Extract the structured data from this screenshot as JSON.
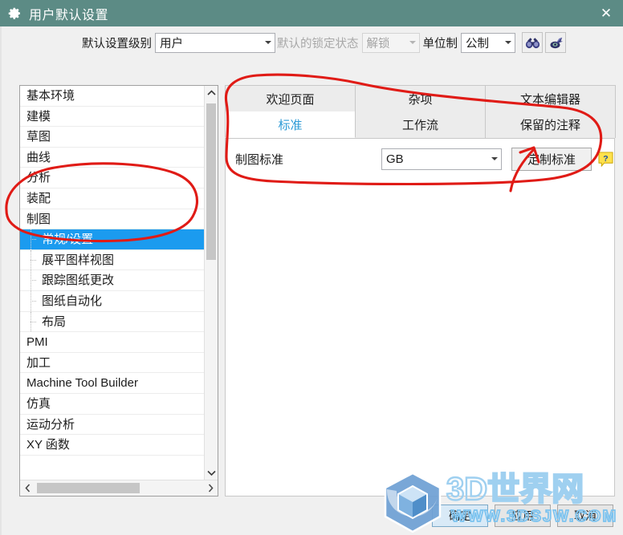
{
  "window": {
    "title": "用户默认设置",
    "gear_icon": "gear-icon",
    "close_label": "✕"
  },
  "toolbar": {
    "level_label": "默认设置级别",
    "level_value": "用户",
    "lock_label": "默认的锁定状态",
    "lock_value": "解锁",
    "lock_disabled": true,
    "units_label": "单位制",
    "units_value": "公制",
    "find_icon": "binoculars-icon",
    "pick_icon": "arrow-pick-icon"
  },
  "tree": {
    "items": [
      {
        "label": "基本环境",
        "level": 0,
        "selected": false
      },
      {
        "label": "建模",
        "level": 0,
        "selected": false
      },
      {
        "label": "草图",
        "level": 0,
        "selected": false
      },
      {
        "label": "曲线",
        "level": 0,
        "selected": false
      },
      {
        "label": "分析",
        "level": 0,
        "selected": false
      },
      {
        "label": "装配",
        "level": 0,
        "selected": false
      },
      {
        "label": "制图",
        "level": 0,
        "selected": false
      },
      {
        "label": "常规/设置",
        "level": 1,
        "selected": true
      },
      {
        "label": "展平图样视图",
        "level": 1,
        "selected": false
      },
      {
        "label": "跟踪图纸更改",
        "level": 1,
        "selected": false
      },
      {
        "label": "图纸自动化",
        "level": 1,
        "selected": false
      },
      {
        "label": "布局",
        "level": 1,
        "selected": false
      },
      {
        "label": "PMI",
        "level": 0,
        "selected": false
      },
      {
        "label": "加工",
        "level": 0,
        "selected": false
      },
      {
        "label": "Machine Tool Builder",
        "level": 0,
        "selected": false
      },
      {
        "label": "仿真",
        "level": 0,
        "selected": false
      },
      {
        "label": "运动分析",
        "level": 0,
        "selected": false
      },
      {
        "label": "XY 函数",
        "level": 0,
        "selected": false
      }
    ],
    "scroll_up_icon": "chevron-up-icon",
    "scroll_down_icon": "chevron-down-icon",
    "scroll_left_icon": "chevron-left-icon",
    "scroll_right_icon": "chevron-right-icon"
  },
  "tabs": {
    "row1": [
      {
        "label": "欢迎页面",
        "active": false
      },
      {
        "label": "杂项",
        "active": false
      },
      {
        "label": "文本编辑器",
        "active": false
      }
    ],
    "row2": [
      {
        "label": "标准",
        "active": true
      },
      {
        "label": "工作流",
        "active": false
      },
      {
        "label": "保留的注释",
        "active": false
      }
    ]
  },
  "content": {
    "drafting_standard_label": "制图标准",
    "drafting_standard_value": "GB",
    "customize_standard_label": "定制标准",
    "help_icon": "help-bubble-icon"
  },
  "footer": {
    "ok_label": "确定",
    "apply_label": "应用",
    "cancel_label": "取消"
  },
  "watermark": {
    "brand": "3D世界网",
    "url": "WWW.3DSJW.COM",
    "logo_icon": "hexagon-cube-logo"
  },
  "colors": {
    "titlebar": "#5c8b85",
    "selection": "#1b9bef",
    "active_tab_text": "#2e9bd6",
    "annotation": "#e01b16"
  }
}
